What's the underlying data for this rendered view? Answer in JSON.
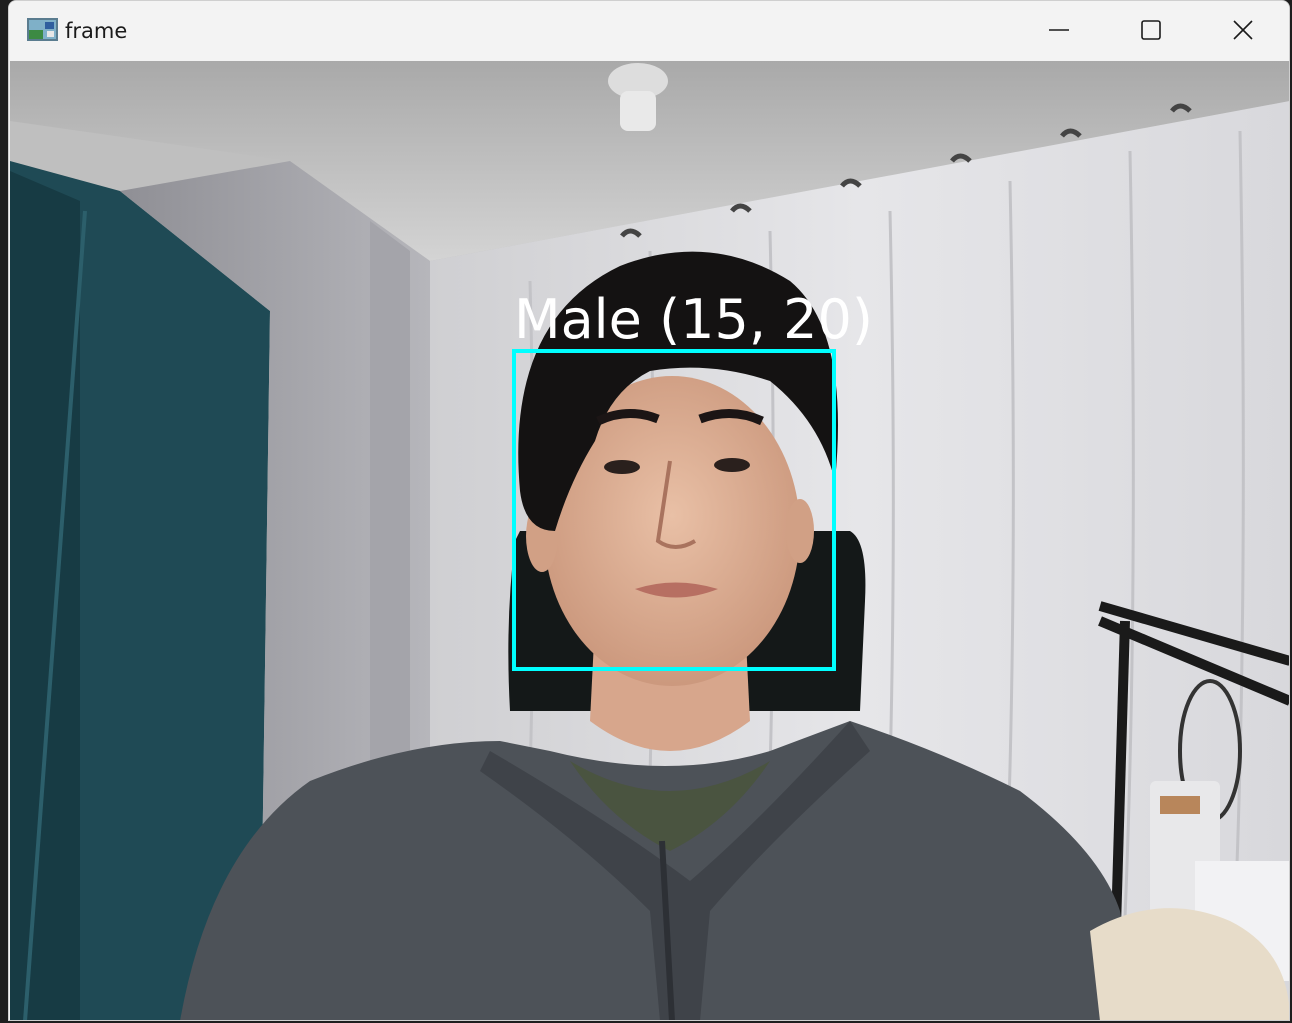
{
  "window": {
    "title": "frame",
    "icon": "opencv-window-icon",
    "buttons": {
      "minimize": "minimize-icon",
      "maximize": "maximize-icon",
      "close": "close-icon"
    }
  },
  "detection": {
    "label": "Male (15, 20)",
    "box_color": "#00ffff",
    "label_color": "#ffffff"
  }
}
